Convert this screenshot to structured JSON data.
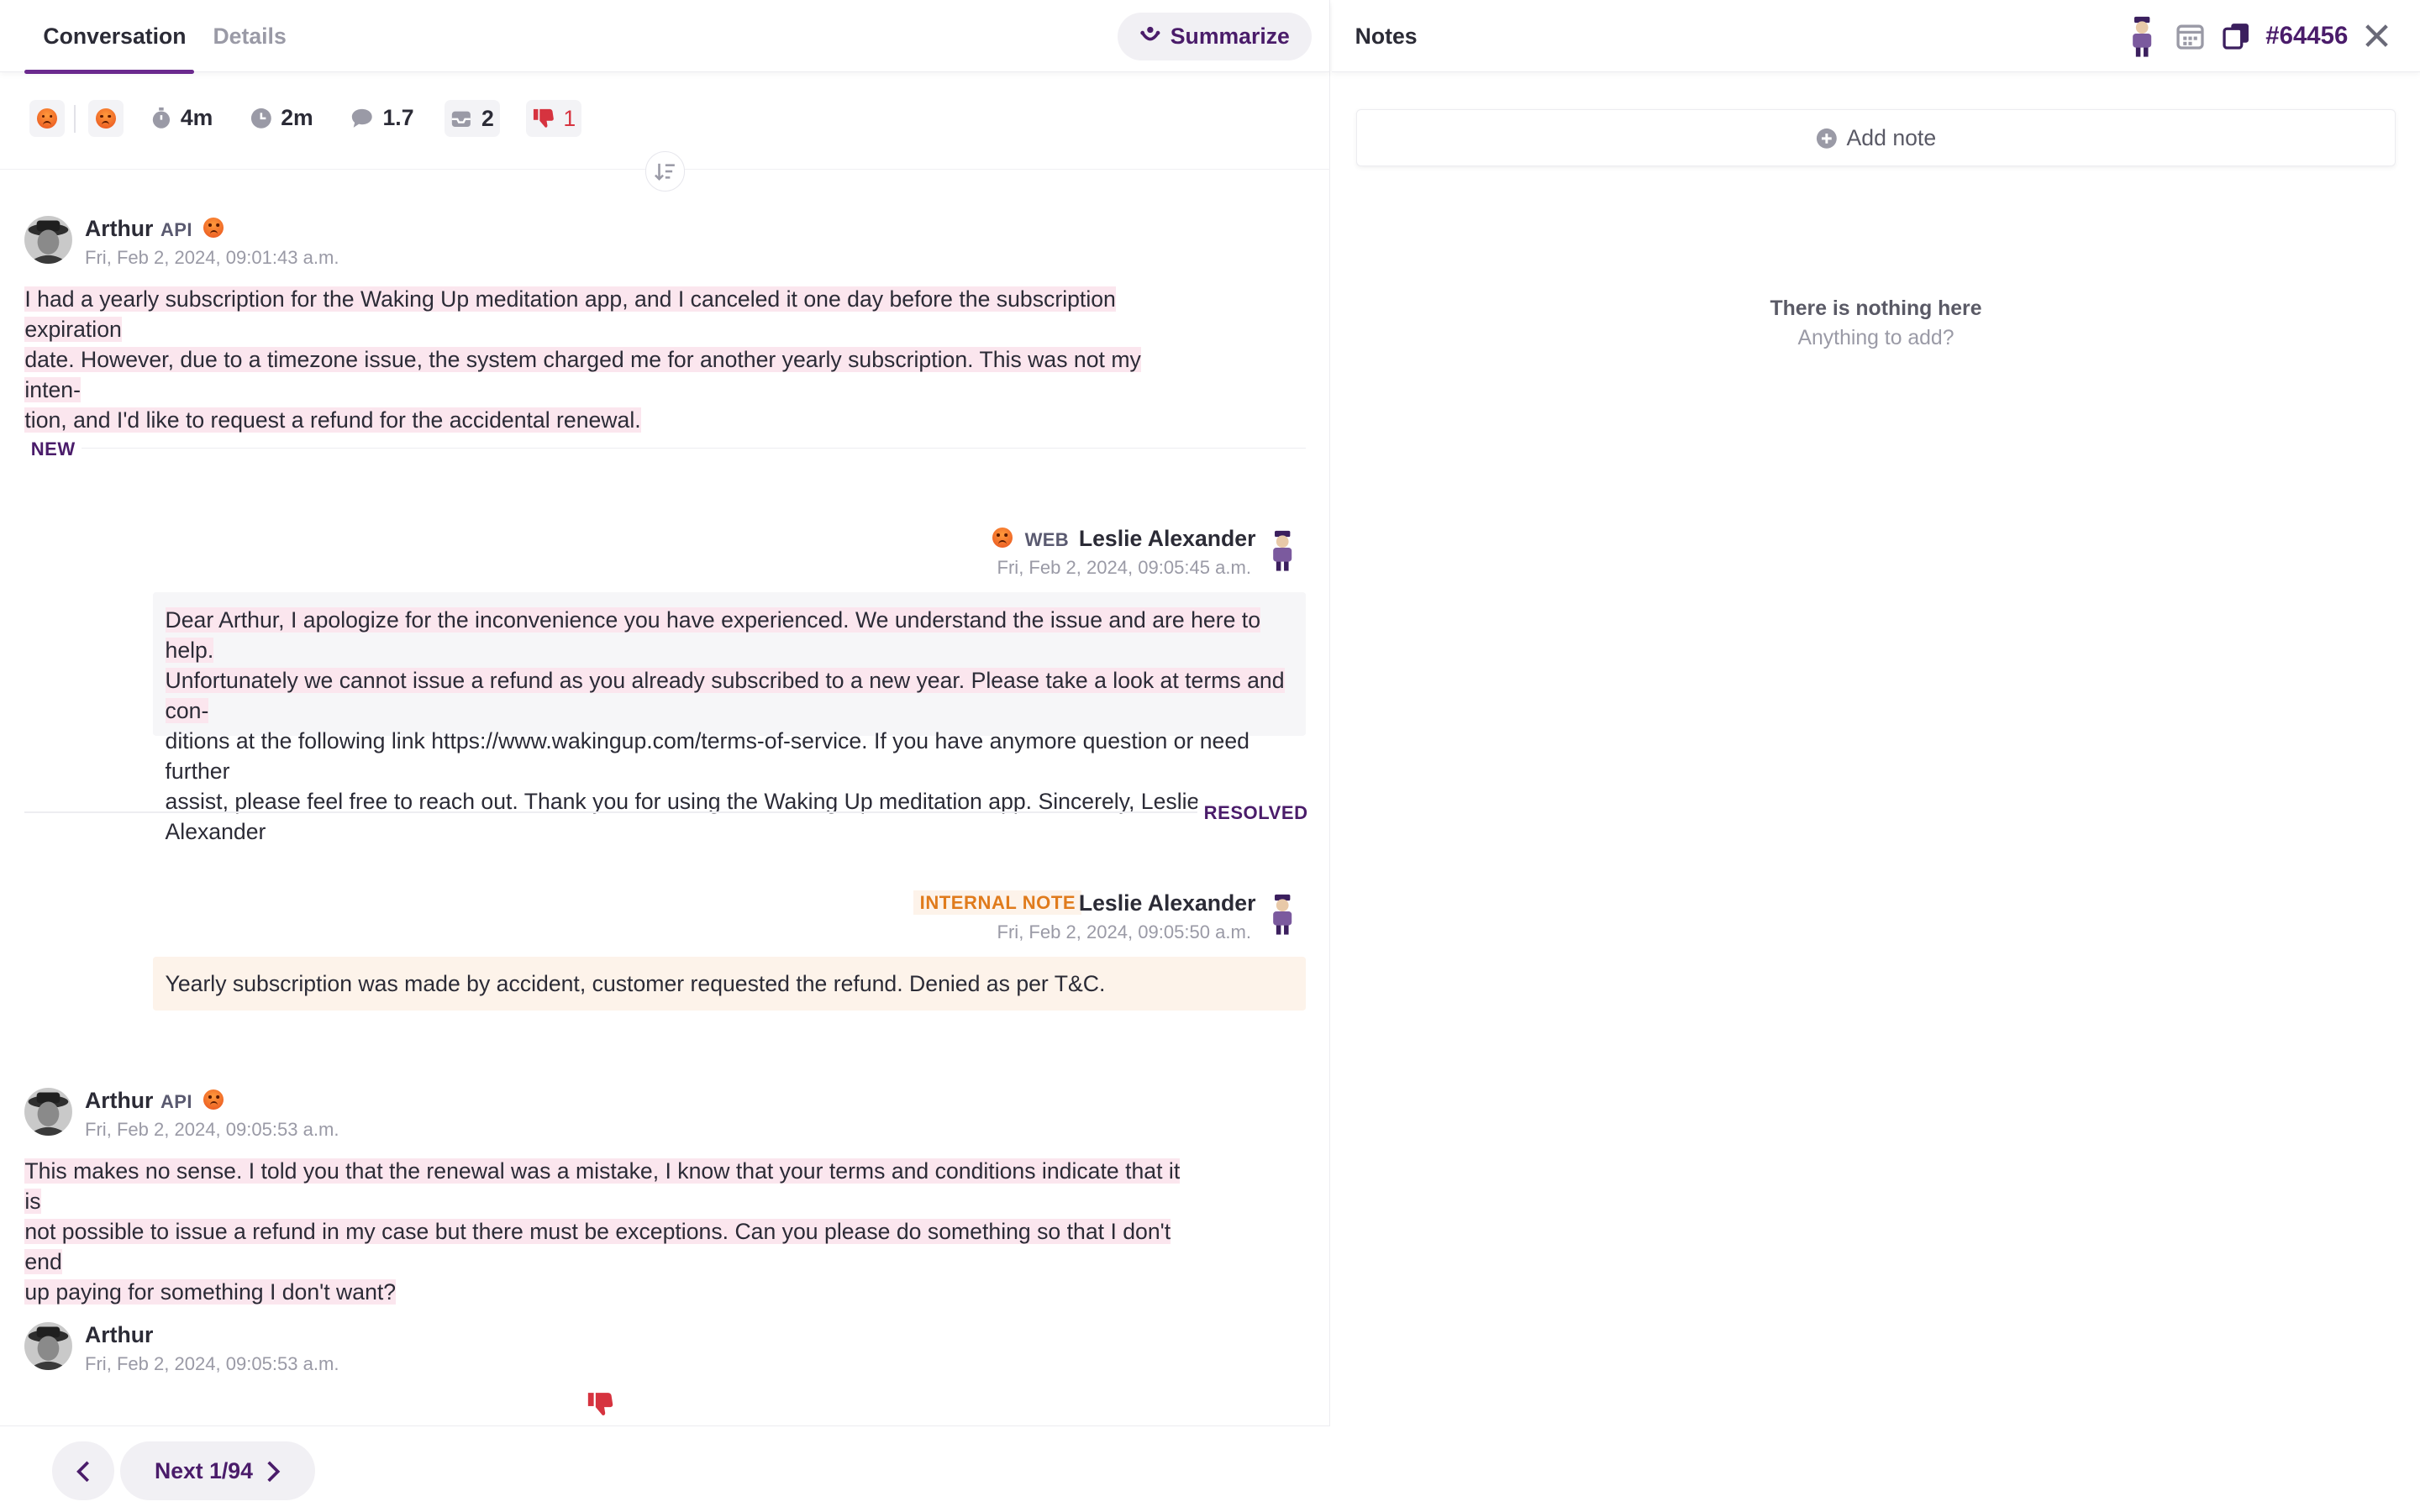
{
  "tabs": {
    "conversation": "Conversation",
    "details": "Details"
  },
  "summarize_label": "Summarize",
  "stats": {
    "handle_time": "4m",
    "response_time": "2m",
    "messages_ratio": "1.7",
    "tickets": "2",
    "thumbs_down": "1"
  },
  "messages": [
    {
      "author": "Arthur",
      "channel": "API",
      "timestamp": "Fri, Feb 2, 2024, 09:01:43 a.m.",
      "lines": [
        "I had a yearly subscription for the Waking Up meditation app, and I canceled it one day before the subscription expiration",
        "date. However, due to a timezone issue, the system charged me for another yearly subscription. This was not my inten-",
        "tion, and I'd like to request a refund for the accidental renewal."
      ]
    },
    {
      "author": "Leslie Alexander",
      "channel": "WEB",
      "timestamp": "Fri, Feb 2, 2024, 09:05:45 a.m.",
      "lines": [
        "Dear Arthur, I apologize for the inconvenience you have experienced. We understand the issue and are here to help.",
        "Unfortunately we cannot issue a refund as you already subscribed to a new year. Please take a look at terms and con-",
        "ditions at the following link https://www.wakingup.com/terms-of-service. If you have anymore question or need further",
        "assist, please feel free to reach out. Thank you for using the Waking Up meditation app. Sincerely, Leslie Alexander"
      ]
    },
    {
      "author": "Leslie Alexander",
      "channel": "INTERNAL NOTE",
      "timestamp": "Fri, Feb 2, 2024, 09:05:50 a.m.",
      "text": "Yearly subscription was made by accident, customer requested the refund. Denied as per T&C."
    },
    {
      "author": "Arthur",
      "channel": "API",
      "timestamp": "Fri, Feb 2, 2024, 09:05:53 a.m.",
      "lines": [
        "This makes no sense. I told you that the renewal was a mistake, I know that your terms and conditions indicate that it is",
        "not possible to issue a refund in my case but there must be exceptions. Can you please do something so that I don't end",
        "up paying for something I don't want?"
      ]
    },
    {
      "author": "Arthur",
      "timestamp": "Fri, Feb 2, 2024, 09:05:53 a.m."
    }
  ],
  "status_new": "NEW",
  "status_resolved": "RESOLVED",
  "pagination": {
    "next_label": "Next 1/94"
  },
  "notes": {
    "title": "Notes",
    "ticket_id": "#64456",
    "add_label": "Add note",
    "empty_title": "There is nothing here",
    "empty_sub": "Anything to add?"
  },
  "colors": {
    "accent": "#4a1c6a",
    "tab_underline": "#6b2a8e",
    "negative": "#d6333f",
    "note": "#e07b1c",
    "highlight": "#fbe6ee"
  }
}
